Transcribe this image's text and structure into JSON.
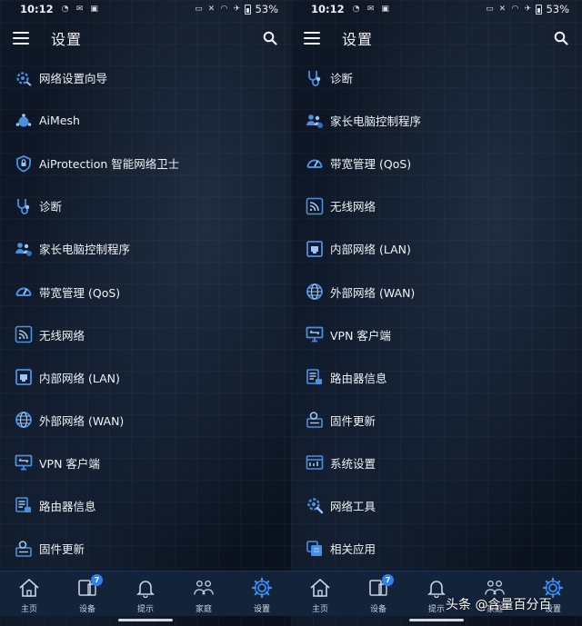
{
  "accent_color": "#4a90e2",
  "status_bar": {
    "time": "10:12",
    "battery": "53%"
  },
  "screens": {
    "left": {
      "title": "设置",
      "items": [
        {
          "label": "网络设置向导",
          "icon": "setup-wizard-icon"
        },
        {
          "label": "AiMesh",
          "icon": "aimesh-icon"
        },
        {
          "label": "AiProtection 智能网络卫士",
          "icon": "aiprotection-icon"
        },
        {
          "label": "诊断",
          "icon": "stethoscope-icon"
        },
        {
          "label": "家长电脑控制程序",
          "icon": "parental-control-icon"
        },
        {
          "label": "带宽管理 (QoS)",
          "icon": "gauge-icon"
        },
        {
          "label": "无线网络",
          "icon": "wifi-icon"
        },
        {
          "label": "内部网络 (LAN)",
          "icon": "lan-port-icon"
        },
        {
          "label": "外部网络 (WAN)",
          "icon": "globe-icon"
        },
        {
          "label": "VPN 客户端",
          "icon": "vpn-monitor-icon"
        },
        {
          "label": "路由器信息",
          "icon": "router-info-icon"
        },
        {
          "label": "固件更新",
          "icon": "firmware-update-icon"
        }
      ]
    },
    "right": {
      "title": "设置",
      "items": [
        {
          "label": "诊断",
          "icon": "stethoscope-icon"
        },
        {
          "label": "家长电脑控制程序",
          "icon": "parental-control-icon"
        },
        {
          "label": "带宽管理 (QoS)",
          "icon": "gauge-icon"
        },
        {
          "label": "无线网络",
          "icon": "wifi-icon"
        },
        {
          "label": "内部网络 (LAN)",
          "icon": "lan-port-icon"
        },
        {
          "label": "外部网络 (WAN)",
          "icon": "globe-icon"
        },
        {
          "label": "VPN 客户端",
          "icon": "vpn-monitor-icon"
        },
        {
          "label": "路由器信息",
          "icon": "router-info-icon"
        },
        {
          "label": "固件更新",
          "icon": "firmware-update-icon"
        },
        {
          "label": "系统设置",
          "icon": "system-settings-icon"
        },
        {
          "label": "网络工具",
          "icon": "network-tools-icon"
        },
        {
          "label": "相关应用",
          "icon": "related-apps-icon"
        }
      ]
    }
  },
  "bottom_nav": {
    "home": "主页",
    "devices": "设备",
    "devices_badge": "7",
    "tips": "提示",
    "family": "家庭",
    "settings": "设置"
  },
  "watermark": "头条 @含量百分百"
}
